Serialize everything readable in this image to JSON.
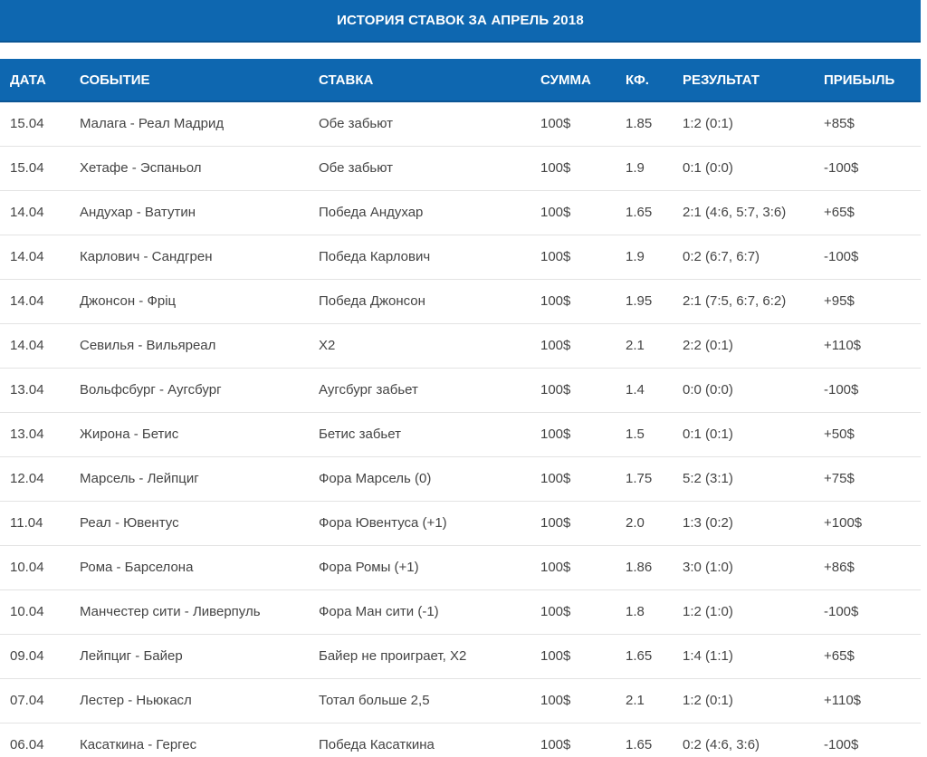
{
  "title": "ИСТОРИЯ СТАВОК ЗА АПРЕЛЬ 2018",
  "colors": {
    "header_bg": "#0e67b0",
    "win": "#3a9a4a",
    "loss": "#d04848",
    "text": "#444444"
  },
  "table": {
    "headers": {
      "date": "ДАТА",
      "event": "СОБЫТИЕ",
      "bet": "СТАВКА",
      "sum": "СУММА",
      "odds": "КФ.",
      "result": "РЕЗУЛЬТАТ",
      "profit": "ПРИБЫЛЬ"
    },
    "rows": [
      {
        "date": "15.04",
        "event": "Малага - Реал Мадрид",
        "bet": "Обе забьют",
        "sum": "100$",
        "odds": "1.85",
        "result": "1:2 (0:1)",
        "profit": "+85$",
        "outcome": "win"
      },
      {
        "date": "15.04",
        "event": "Хетафе - Эспаньол",
        "bet": "Обе забьют",
        "sum": "100$",
        "odds": "1.9",
        "result": "0:1 (0:0)",
        "profit": "-100$",
        "outcome": "loss"
      },
      {
        "date": "14.04",
        "event": "Андухар - Ватутин",
        "bet": "Победа Андухар",
        "sum": "100$",
        "odds": "1.65",
        "result": "2:1 (4:6, 5:7, 3:6)",
        "profit": "+65$",
        "outcome": "win"
      },
      {
        "date": "14.04",
        "event": "Карлович - Сандгрен",
        "bet": "Победа Карлович",
        "sum": "100$",
        "odds": "1.9",
        "result": "0:2 (6:7, 6:7)",
        "profit": "-100$",
        "outcome": "loss"
      },
      {
        "date": "14.04",
        "event": "Джонсон - Фріц",
        "bet": "Победа Джонсон",
        "sum": "100$",
        "odds": "1.95",
        "result": "2:1 (7:5, 6:7, 6:2)",
        "profit": "+95$",
        "outcome": "win"
      },
      {
        "date": "14.04",
        "event": "Севилья - Вильяреал",
        "bet": "Х2",
        "sum": "100$",
        "odds": "2.1",
        "result": "2:2 (0:1)",
        "profit": "+110$",
        "outcome": "win"
      },
      {
        "date": "13.04",
        "event": "Вольфсбург - Аугсбург",
        "bet": "Аугсбург забьет",
        "sum": "100$",
        "odds": "1.4",
        "result": "0:0 (0:0)",
        "profit": "-100$",
        "outcome": "loss"
      },
      {
        "date": "13.04",
        "event": "Жирона - Бетис",
        "bet": "Бетис забьет",
        "sum": "100$",
        "odds": "1.5",
        "result": "0:1 (0:1)",
        "profit": "+50$",
        "outcome": "win"
      },
      {
        "date": "12.04",
        "event": "Марсель - Лейпциг",
        "bet": "Фора Марсель (0)",
        "sum": "100$",
        "odds": "1.75",
        "result": "5:2 (3:1)",
        "profit": "+75$",
        "outcome": "win"
      },
      {
        "date": "11.04",
        "event": "Реал - Ювентус",
        "bet": "Фора Ювентуса (+1)",
        "sum": "100$",
        "odds": "2.0",
        "result": "1:3 (0:2)",
        "profit": "+100$",
        "outcome": "win"
      },
      {
        "date": "10.04",
        "event": "Рома - Барселона",
        "bet": "Фора Ромы (+1)",
        "sum": "100$",
        "odds": "1.86",
        "result": "3:0 (1:0)",
        "profit": "+86$",
        "outcome": "win"
      },
      {
        "date": "10.04",
        "event": "Манчестер сити - Ливерпуль",
        "bet": "Фора Ман сити (-1)",
        "sum": "100$",
        "odds": "1.8",
        "result": "1:2 (1:0)",
        "profit": "-100$",
        "outcome": "loss"
      },
      {
        "date": "09.04",
        "event": "Лейпциг - Байер",
        "bet": "Байер не проиграет, Х2",
        "sum": "100$",
        "odds": "1.65",
        "result": "1:4 (1:1)",
        "profit": "+65$",
        "outcome": "win"
      },
      {
        "date": "07.04",
        "event": "Лестер - Ньюкасл",
        "bet": "Тотал больше 2,5",
        "sum": "100$",
        "odds": "2.1",
        "result": "1:2 (0:1)",
        "profit": "+110$",
        "outcome": "win"
      },
      {
        "date": "06.04",
        "event": "Касаткина - Гергес",
        "bet": "Победа Касаткина",
        "sum": "100$",
        "odds": "1.65",
        "result": "0:2 (4:6, 3:6)",
        "profit": "-100$",
        "outcome": "loss"
      }
    ]
  }
}
